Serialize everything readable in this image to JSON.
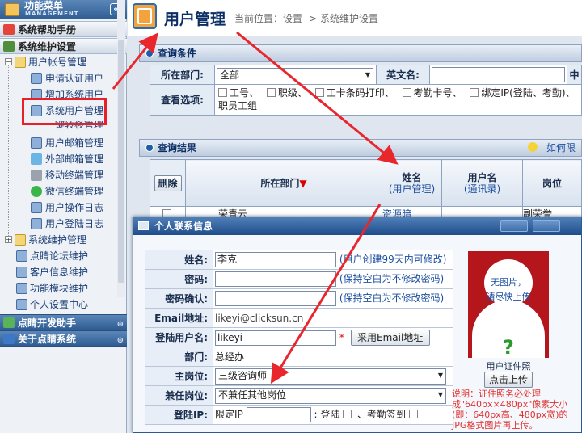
{
  "sidebar": {
    "header_title": "功能菜单",
    "header_subtitle": "MANAGEMENT",
    "collapse_glyph": "«",
    "sections": [
      {
        "label": "系统帮助手册",
        "toggle": "⊕"
      },
      {
        "label": "系统维护设置",
        "toggle": "⊖"
      }
    ],
    "tree": [
      {
        "label": "用户帐号管理",
        "box": "−"
      },
      {
        "label": "申请认证用户"
      },
      {
        "label": "增加系统用户"
      },
      {
        "label": "系统用户管理"
      },
      {
        "label": "一键转移管理"
      },
      {
        "label": "用户邮箱管理"
      },
      {
        "label": "外部邮箱管理"
      },
      {
        "label": "移动终端管理"
      },
      {
        "label": "微信终端管理"
      },
      {
        "label": "用户操作日志"
      },
      {
        "label": "用户登陆日志"
      },
      {
        "label": "系统维护管理",
        "box": "+"
      },
      {
        "label": "点睛论坛维护"
      },
      {
        "label": "客户信息维护"
      },
      {
        "label": "功能模块维护"
      },
      {
        "label": "个人设置中心"
      }
    ],
    "bottom_sections": [
      {
        "label": "点睛开发助手",
        "toggle": "⊕"
      },
      {
        "label": "关于点睛系统",
        "toggle": "⊕"
      }
    ]
  },
  "header": {
    "title": "用户管理",
    "breadcrumb": "当前位置：设置 -> 系统维护设置"
  },
  "query": {
    "panel_title": "查询条件",
    "dept_label": "所在部门:",
    "dept_value": "全部",
    "ename_label": "英文名:",
    "cut_label": "中",
    "options_label": "查看选项:",
    "options": [
      "工号、",
      "职级、",
      "工卡条码打印、",
      "考勤卡号、",
      "绑定IP(登陆、考勤)、"
    ],
    "options_line2": "职员工组"
  },
  "results": {
    "panel_title": "查询结果",
    "help_link": "如何限制",
    "delete_button": "删除",
    "col_dept": "所在部门",
    "sort_glyph": "▼",
    "col_name": "姓名",
    "col_name_sub": "(用户管理)",
    "col_user": "用户名",
    "col_user_sub": "(通讯录)",
    "col_pos": "岗位",
    "row_partial": [
      "荣青云",
      "资源暗",
      "副荣誉"
    ]
  },
  "dialog": {
    "title": "个人联系信息",
    "fields": {
      "name_label": "姓名:",
      "name_value": "李克一",
      "name_hint": "(用户创建99天内可修改)",
      "pwd_label": "密码:",
      "pwd_hint": "(保持空白为不修改密码)",
      "pwd2_label": "密码确认:",
      "pwd2_hint": "(保持空白为不修改密码)",
      "email_label": "Email地址:",
      "email_value": "likeyi@clicksun.cn",
      "login_label": "登陆用户名:",
      "login_value": "likeyi",
      "login_req": "*",
      "email_btn": "采用Email地址",
      "dept_label": "部门:",
      "dept_value": "总经办",
      "pos_label": "主岗位:",
      "pos_value": "三级咨询师",
      "pos2_label": "兼任岗位:",
      "pos2_value": "不兼任其他岗位",
      "ip_label": "登陆IP:",
      "ip_prefix": "限定IP",
      "ip_login": "登陆",
      "ip_att": "、考勤签到"
    },
    "photo": {
      "line1": "无图片，",
      "line2": "请尽快上传",
      "qmark": "?",
      "caption": "用户证件照",
      "upload_btn": "点击上传",
      "note": "说明：证件照务必处理成\"640px×480px\"像素大小(即：640px高、480px宽)的JPG格式图片再上传。"
    }
  },
  "colors": {
    "annotation": "#e8202a",
    "brand": "#1f4d8a"
  }
}
